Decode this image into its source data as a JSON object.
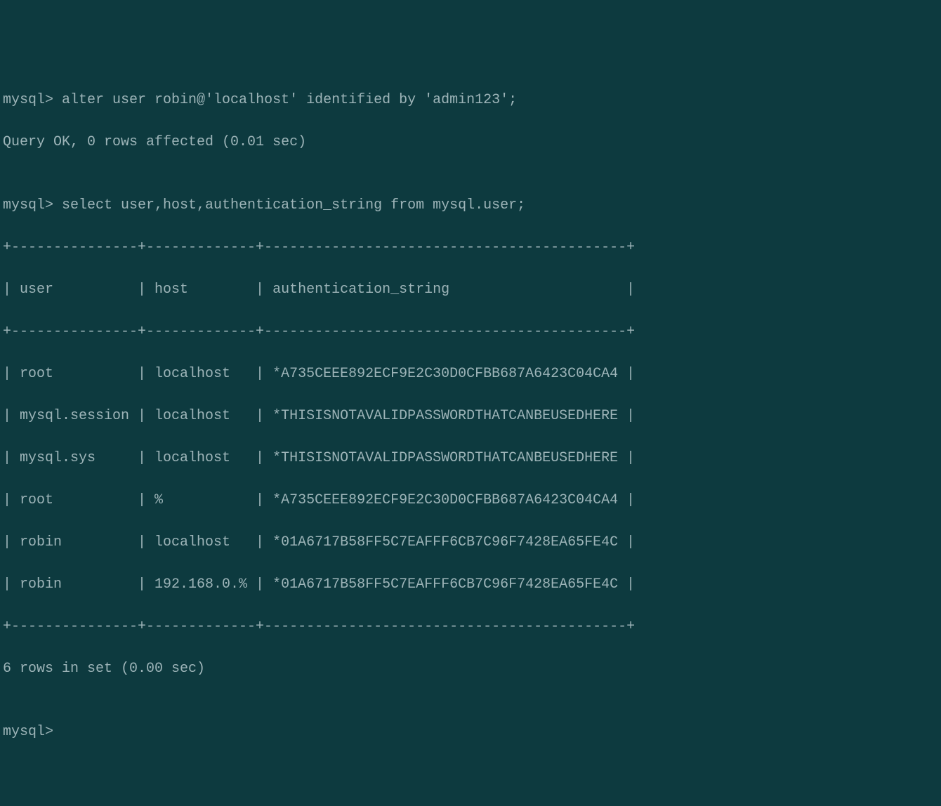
{
  "terminal": {
    "prompt": "mysql>",
    "command1": " alter user robin@'localhost' identified by 'admin123';",
    "result1": "Query OK, 0 rows affected (0.01 sec)",
    "blank1": "",
    "command2": " select user,host,authentication_string from mysql.user;",
    "table_border": "+---------------+-------------+-------------------------------------------+",
    "header_row": "| user          | host        | authentication_string                     |",
    "rows": [
      "| root          | localhost   | *A735CEEE892ECF9E2C30D0CFBB687A6423C04CA4 |",
      "| mysql.session | localhost   | *THISISNOTAVALIDPASSWORDTHATCANBEUSEDHERE |",
      "| mysql.sys     | localhost   | *THISISNOTAVALIDPASSWORDTHATCANBEUSEDHERE |",
      "| root          | %           | *A735CEEE892ECF9E2C30D0CFBB687A6423C04CA4 |",
      "| robin         | localhost   | *01A6717B58FF5C7EAFFF6CB7C96F7428EA65FE4C |",
      "| robin         | 192.168.0.% | *01A6717B58FF5C7EAFFF6CB7C96F7428EA65FE4C |"
    ],
    "result2": "6 rows in set (0.00 sec)",
    "blank2": ""
  },
  "chart_data": {
    "type": "table",
    "columns": [
      "user",
      "host",
      "authentication_string"
    ],
    "data": [
      {
        "user": "root",
        "host": "localhost",
        "authentication_string": "*A735CEEE892ECF9E2C30D0CFBB687A6423C04CA4"
      },
      {
        "user": "mysql.session",
        "host": "localhost",
        "authentication_string": "*THISISNOTAVALIDPASSWORDTHATCANBEUSEDHERE"
      },
      {
        "user": "mysql.sys",
        "host": "localhost",
        "authentication_string": "*THISISNOTAVALIDPASSWORDTHATCANBEUSEDHERE"
      },
      {
        "user": "root",
        "host": "%",
        "authentication_string": "*A735CEEE892ECF9E2C30D0CFBB687A6423C04CA4"
      },
      {
        "user": "robin",
        "host": "localhost",
        "authentication_string": "*01A6717B58FF5C7EAFFF6CB7C96F7428EA65FE4C"
      },
      {
        "user": "robin",
        "host": "192.168.0.%",
        "authentication_string": "*01A6717B58FF5C7EAFFF6CB7C96F7428EA65FE4C"
      }
    ]
  }
}
